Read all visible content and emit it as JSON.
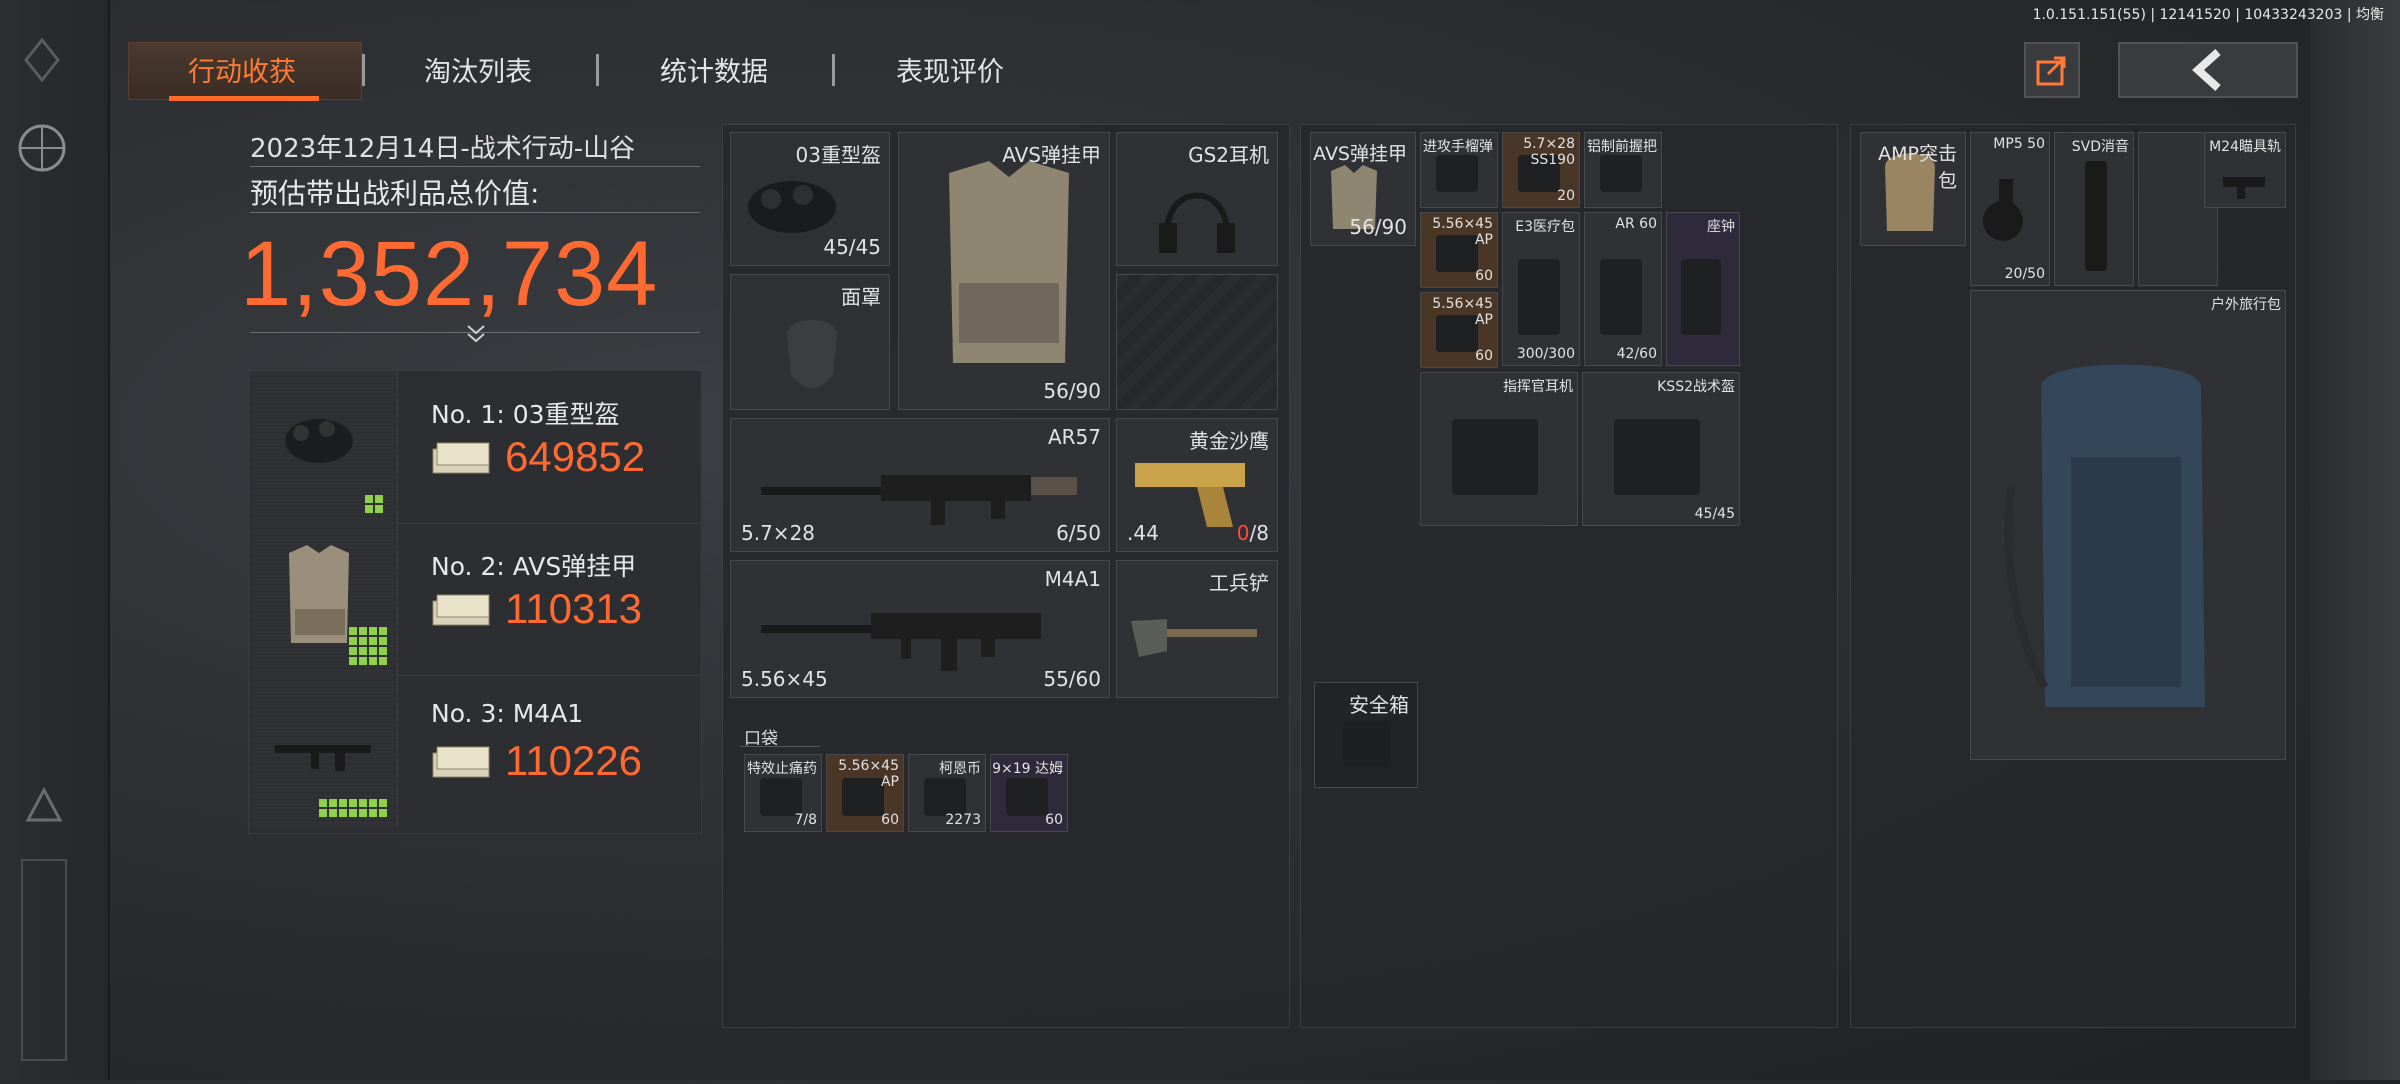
{
  "version_info": "1.0.151.151(55) | 12141520 | 10433243203 | 均衡",
  "tabs": [
    {
      "label": "行动收获",
      "active": true
    },
    {
      "label": "淘汰列表",
      "active": false
    },
    {
      "label": "统计数据",
      "active": false
    },
    {
      "label": "表现评价",
      "active": false
    }
  ],
  "summary": {
    "date_line": "2023年12月14日-战术行动-山谷",
    "estimate_label": "预估带出战利品总价值:",
    "total_value": "1,352,734"
  },
  "top_items": [
    {
      "rank_label": "No. 1: 03重型盔",
      "value": "649852",
      "grid": [
        2,
        2
      ]
    },
    {
      "rank_label": "No. 2: AVS弹挂甲",
      "value": "110313",
      "grid": [
        4,
        4
      ]
    },
    {
      "rank_label": "No. 3: M4A1",
      "value": "110226",
      "grid": [
        7,
        2
      ]
    }
  ],
  "equipment": {
    "helmet": {
      "name": "03重型盔",
      "durability": "45/45"
    },
    "armor": {
      "name": "AVS弹挂甲",
      "durability": "56/90"
    },
    "headset": {
      "name": "GS2耳机"
    },
    "mask": {
      "name": "面罩"
    },
    "primary": {
      "name": "AR57",
      "caliber": "5.7×28",
      "ammo": "6/50"
    },
    "pistol": {
      "name": "黄金沙鹰",
      "caliber": ".44",
      "ammo_current": "0",
      "ammo_max": "/8"
    },
    "secondary": {
      "name": "M4A1",
      "caliber": "5.56×45",
      "ammo": "55/60"
    },
    "melee": {
      "name": "工兵铲"
    }
  },
  "pocket": {
    "label": "口袋",
    "items": [
      {
        "name": "特效止痛药",
        "count": "7/8",
        "count_red": true
      },
      {
        "name": "5.56×45 AP",
        "count": "60"
      },
      {
        "name": "柯恩币",
        "count": "2273"
      },
      {
        "name": "9×19 达姆",
        "count": "60"
      }
    ]
  },
  "rig": {
    "name": "AVS弹挂甲",
    "durability": "56/90",
    "items": [
      {
        "name": "进攻手榴弹",
        "count": ""
      },
      {
        "name": "5.7×28 SS190",
        "count": "20"
      },
      {
        "name": "铝制前握把",
        "count": ""
      },
      {
        "name": "5.56×45 AP",
        "count": "60"
      },
      {
        "name": "E3医疗包",
        "count": "300/300",
        "count_red": true
      },
      {
        "name": "AR 60",
        "count": "42/60"
      },
      {
        "name": "座钟",
        "count": ""
      },
      {
        "name": "5.56×45 AP",
        "count": "60"
      },
      {
        "name": "指挥官耳机",
        "count": ""
      },
      {
        "name": "KSS2战术盔",
        "count": "45/45"
      }
    ]
  },
  "safebox": {
    "label": "安全箱"
  },
  "backpack": {
    "name": "AMP突击包",
    "items": [
      {
        "name": "MP5 50",
        "count": "20/50"
      },
      {
        "name": "SVD消音",
        "count": ""
      },
      {
        "name": "M24瞄具轨",
        "count": ""
      },
      {
        "name": "户外旅行包",
        "count": ""
      }
    ]
  },
  "colors": {
    "accent": "#ff6a33",
    "grid_green": "#8fd24a",
    "red": "#ff4a3a"
  }
}
